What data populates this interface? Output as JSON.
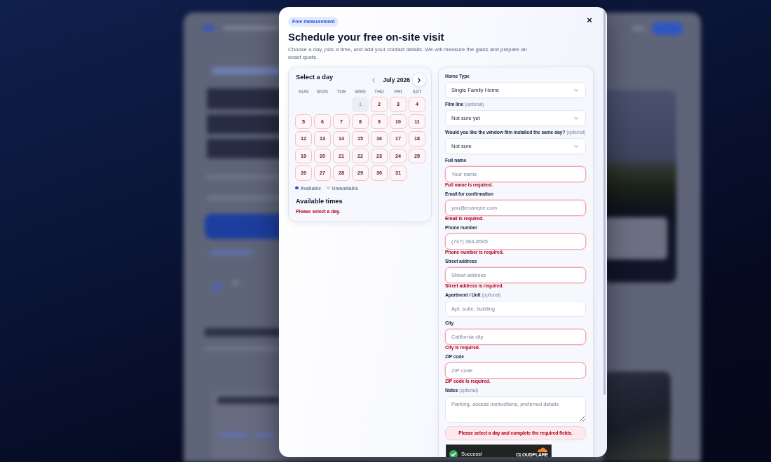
{
  "dialog": {
    "badge": "Free measurement",
    "close": "×",
    "title": "Schedule your free on-site visit",
    "subtitle": "Choose a day, pick a time, and add your contact details. We will measure the glass and prepare an exact quote."
  },
  "calendar": {
    "heading": "Select a day",
    "month": "July 2026",
    "prev_button": {
      "disabled": true
    },
    "next_button": {
      "disabled": false
    },
    "weekdays": [
      "SUN",
      "MON",
      "TUE",
      "WED",
      "THU",
      "FRI",
      "SAT"
    ],
    "weeks": [
      [
        {
          "kind": "blank"
        },
        {
          "kind": "blank"
        },
        {
          "kind": "blank"
        },
        {
          "kind": "day",
          "label": "1",
          "available": false,
          "selected": false
        },
        {
          "kind": "day",
          "label": "2",
          "available": true,
          "selected": false
        },
        {
          "kind": "day",
          "label": "3",
          "available": true,
          "selected": false
        },
        {
          "kind": "day",
          "label": "4",
          "available": true,
          "selected": false
        }
      ],
      [
        {
          "kind": "day",
          "label": "5",
          "available": true,
          "selected": false
        },
        {
          "kind": "day",
          "label": "6",
          "available": true,
          "selected": false
        },
        {
          "kind": "day",
          "label": "7",
          "available": true,
          "selected": false
        },
        {
          "kind": "day",
          "label": "8",
          "available": true,
          "selected": false
        },
        {
          "kind": "day",
          "label": "9",
          "available": true,
          "selected": false
        },
        {
          "kind": "day",
          "label": "10",
          "available": true,
          "selected": false
        },
        {
          "kind": "day",
          "label": "11",
          "available": true,
          "selected": false
        }
      ],
      [
        {
          "kind": "day",
          "label": "12",
          "available": true,
          "selected": false
        },
        {
          "kind": "day",
          "label": "13",
          "available": true,
          "selected": false
        },
        {
          "kind": "day",
          "label": "14",
          "available": true,
          "selected": false
        },
        {
          "kind": "day",
          "label": "15",
          "available": true,
          "selected": false
        },
        {
          "kind": "day",
          "label": "16",
          "available": true,
          "selected": false
        },
        {
          "kind": "day",
          "label": "17",
          "available": true,
          "selected": false
        },
        {
          "kind": "day",
          "label": "18",
          "available": true,
          "selected": false
        }
      ],
      [
        {
          "kind": "day",
          "label": "19",
          "available": true,
          "selected": false
        },
        {
          "kind": "day",
          "label": "20",
          "available": true,
          "selected": false
        },
        {
          "kind": "day",
          "label": "21",
          "available": true,
          "selected": false
        },
        {
          "kind": "day",
          "label": "22",
          "available": true,
          "selected": false
        },
        {
          "kind": "day",
          "label": "23",
          "available": true,
          "selected": false
        },
        {
          "kind": "day",
          "label": "24",
          "available": true,
          "selected": false
        },
        {
          "kind": "day",
          "label": "25",
          "available": true,
          "selected": false
        }
      ],
      [
        {
          "kind": "day",
          "label": "26",
          "available": true,
          "selected": false
        },
        {
          "kind": "day",
          "label": "27",
          "available": true,
          "selected": false
        },
        {
          "kind": "day",
          "label": "28",
          "available": true,
          "selected": false
        },
        {
          "kind": "day",
          "label": "29",
          "available": true,
          "selected": false
        },
        {
          "kind": "day",
          "label": "30",
          "available": true,
          "selected": false
        },
        {
          "kind": "day",
          "label": "31",
          "available": true,
          "selected": false
        }
      ]
    ],
    "legend": [
      {
        "label": "Available",
        "color": "#1d4ed8"
      },
      {
        "label": "Unavailable",
        "color": "#ccd2df"
      }
    ],
    "times_heading": "Available times",
    "times_error": "Please select a day."
  },
  "form": {
    "fields": [
      {
        "kind": "select",
        "label": "Home Type",
        "value": "Single Family Home"
      },
      {
        "kind": "select",
        "label": "Film line",
        "optional": "(optional)",
        "value": "Not sure yet"
      },
      {
        "kind": "select",
        "label": "Would you like the window film installed the same day?",
        "optional": "(optional)",
        "value": "Not sure"
      },
      {
        "kind": "input",
        "label": "Full name",
        "placeholder": "Your name",
        "error": "Full name is required."
      },
      {
        "kind": "input",
        "label": "Email for confirmation",
        "placeholder": "you@example.com",
        "error": "Email is required."
      },
      {
        "kind": "input",
        "label": "Phone number",
        "placeholder": "(747) 364-8505",
        "error": "Phone number is required."
      },
      {
        "kind": "input",
        "label": "Street address",
        "placeholder": "Street address",
        "error": "Street address is required."
      },
      {
        "kind": "input",
        "label": "Apartment / Unit",
        "optional": "(optional)",
        "placeholder": "Apt, suite, building"
      },
      {
        "kind": "input",
        "label": "City",
        "placeholder": "California city",
        "error": "City is required."
      },
      {
        "kind": "input",
        "label": "ZIP code",
        "placeholder": "ZIP code",
        "error": "ZIP code is required."
      },
      {
        "kind": "textarea",
        "label": "Notes",
        "optional": "(optional)",
        "placeholder": "Parking, access instructions, preferred details"
      }
    ],
    "alert": "Please select a day and complete the required fields.",
    "captcha": {
      "verified": true,
      "status": "Success!",
      "brand": "CLOUDFLARE"
    }
  }
}
